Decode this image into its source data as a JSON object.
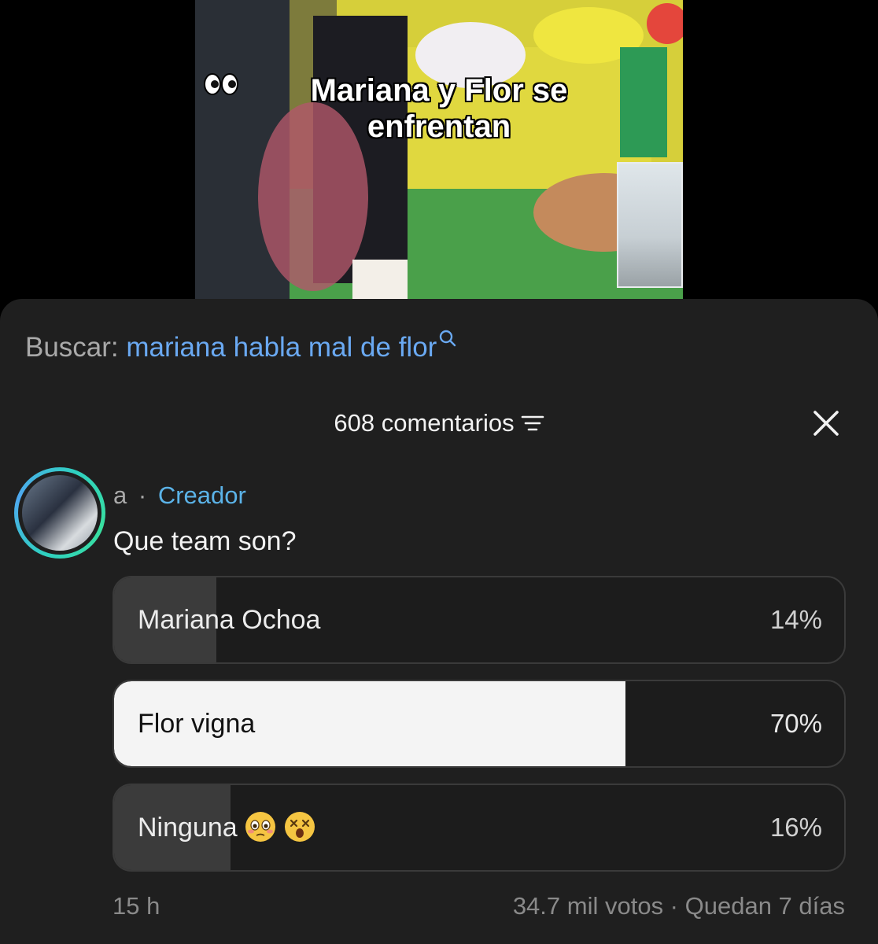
{
  "video": {
    "caption_line1": "Mariana y Flor se",
    "caption_line2": "enfrentan",
    "caption_emoji": "eyes-icon"
  },
  "search": {
    "label": "Buscar:",
    "query": "mariana habla mal de flor",
    "icon": "search-icon"
  },
  "comments": {
    "count_label": "608 comentarios",
    "filter_icon": "filter-icon",
    "close_icon": "close-icon"
  },
  "comment": {
    "author": "a",
    "separator": "·",
    "badge": "Creador",
    "text": "Que team son?",
    "ring_colors": [
      "#2fd0c0",
      "#4fa8f0"
    ],
    "badge_color": "#5bb3e8"
  },
  "poll": {
    "options": [
      {
        "label": "Mariana Ochoa",
        "percent_label": "14%",
        "fraction": 0.14,
        "selected": false
      },
      {
        "label": "Flor vigna",
        "percent_label": "70%",
        "fraction": 0.7,
        "selected": true
      },
      {
        "label": "Ninguna",
        "percent_label": "16%",
        "fraction": 0.16,
        "selected": false,
        "emojis": [
          "flushed-face-icon",
          "dizzy-face-icon"
        ]
      }
    ],
    "fill_color": "#3b3b3b",
    "selected_fill_color": "#f4f4f4",
    "time_ago": "15 h",
    "votes_label": "34.7 mil votos · Quedan 7 días"
  }
}
